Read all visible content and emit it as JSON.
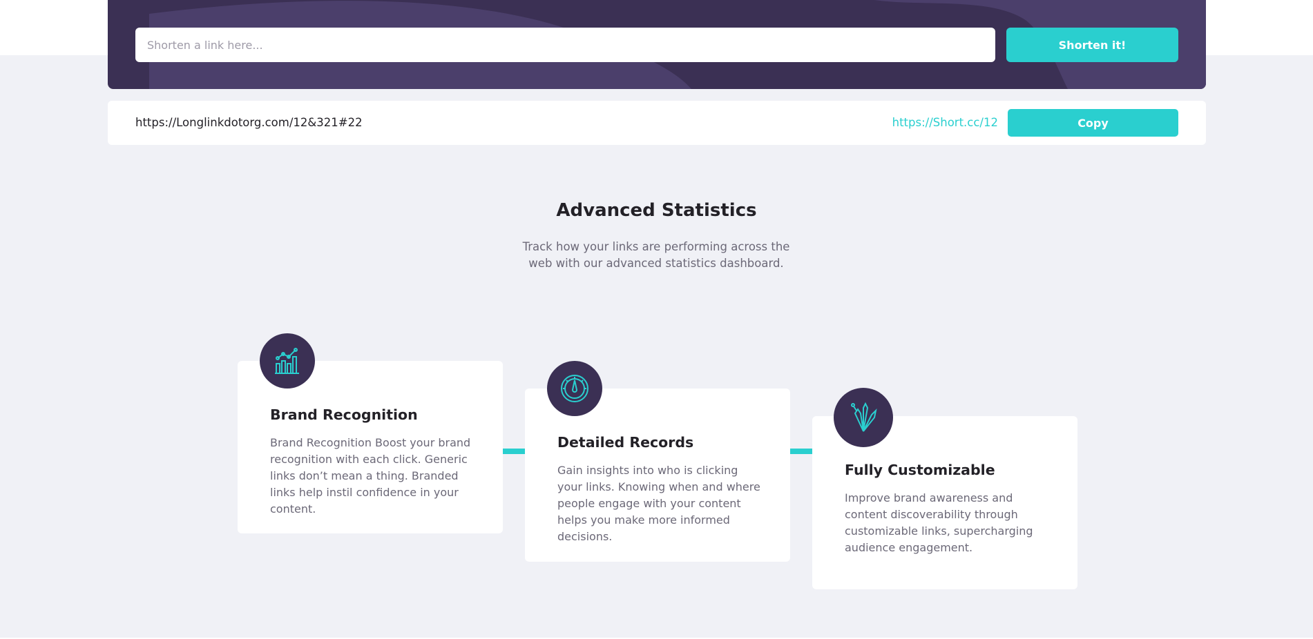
{
  "shorten": {
    "placeholder": "Shorten a link here...",
    "button_label": "Shorten it!"
  },
  "result": {
    "long_url": "https://Longlinkdotorg.com/12&321#22",
    "short_url": "https://Short.cc/12",
    "copy_label": "Copy"
  },
  "statistics": {
    "title": "Advanced Statistics",
    "subtitle": "Track how your links are performing across the web with our advanced statistics dashboard."
  },
  "cards": [
    {
      "icon": "bar-chart-icon",
      "title": "Brand Recognition",
      "text": "Brand Recognition Boost your brand recognition with each click. Generic links don’t mean a thing. Branded links help instil confidence in your content."
    },
    {
      "icon": "speedometer-icon",
      "title": "Detailed Records",
      "text": "Gain insights into who is clicking your links. Knowing when and where people engage with your content helps you make more informed decisions."
    },
    {
      "icon": "pens-icon",
      "title": "Fully Customizable",
      "text": "Improve brand awareness and content discoverability through customizable links, supercharging audience engagement."
    }
  ],
  "colors": {
    "accent": "#2acfcf",
    "dark_violet": "#3b3054",
    "background": "#f0f1f6"
  }
}
